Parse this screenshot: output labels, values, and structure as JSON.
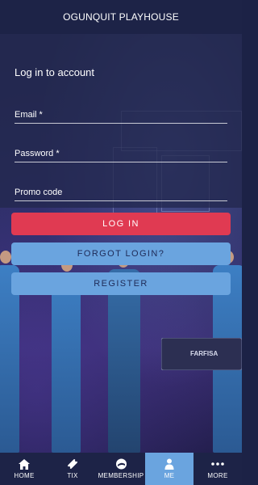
{
  "header": {
    "title": "OGUNQUIT PLAYHOUSE"
  },
  "login": {
    "heading": "Log in to account",
    "email_placeholder": "Email *",
    "password_placeholder": "Password *",
    "promo_placeholder": "Promo code",
    "login_label": "LOG IN",
    "forgot_label": "FORGOT LOGIN?",
    "register_label": "REGISTER"
  },
  "keyboard_brand": "FARFISA",
  "tabs": [
    {
      "label": "HOME",
      "icon": "home-icon"
    },
    {
      "label": "TIX",
      "icon": "ticket-icon"
    },
    {
      "label": "MEMBERSHIP",
      "icon": "membership-icon"
    },
    {
      "label": "ME",
      "icon": "person-icon",
      "active": true
    },
    {
      "label": "MORE",
      "icon": "more-icon"
    }
  ],
  "colors": {
    "background": "#1d2347",
    "login_button": "#e03a52",
    "secondary_button": "#6aa4df",
    "active_tab": "#6aa4df"
  }
}
